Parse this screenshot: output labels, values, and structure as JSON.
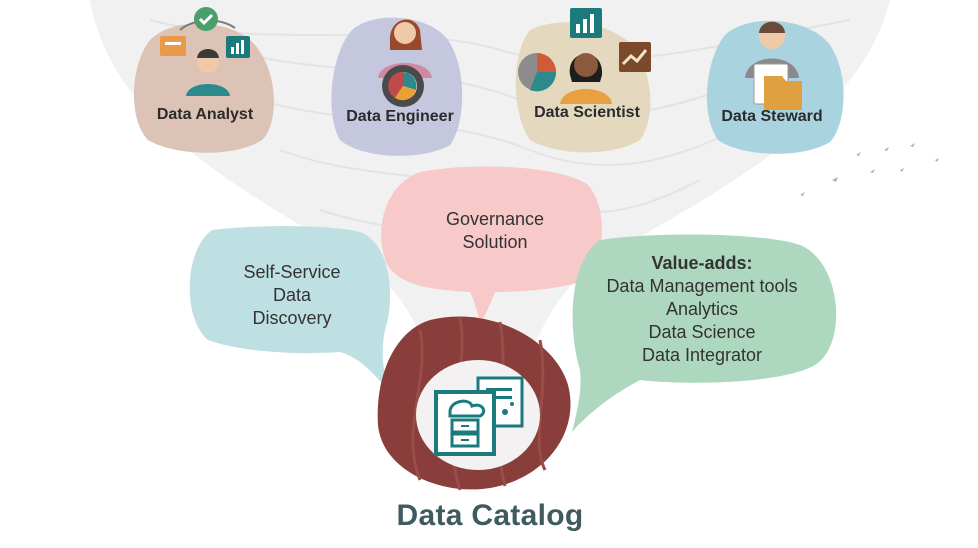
{
  "roles": [
    {
      "label": "Data Analyst",
      "icon": "data-analyst-icon"
    },
    {
      "label": "Data Engineer",
      "icon": "data-engineer-icon"
    },
    {
      "label": "Data Scientist",
      "icon": "data-scientist-icon"
    },
    {
      "label": "Data Steward",
      "icon": "data-steward-icon"
    }
  ],
  "bubbles": {
    "self_service": [
      "Self-Service",
      "Data",
      "Discovery"
    ],
    "governance": [
      "Governance",
      "Solution"
    ],
    "value_adds": {
      "heading": "Value-adds:",
      "items": [
        "Data Management tools",
        "Analytics",
        "Data Science",
        "Data Integrator"
      ]
    }
  },
  "center": {
    "title": "Data Catalog",
    "icon": "data-catalog-icon"
  },
  "colors": {
    "analyst_blob": "#dcc3b6",
    "engineer_blob": "#c5c7df",
    "scientist_blob": "#e4d9bf",
    "steward_blob": "#a9d3df",
    "self_service_bubble": "#bfe0e3",
    "governance_bubble": "#f7c9c9",
    "value_adds_bubble": "#aed7bf",
    "catalog_blob": "#8a3e3c",
    "catalog_icon": "#1a7a7c",
    "title": "#3f5b5f"
  }
}
